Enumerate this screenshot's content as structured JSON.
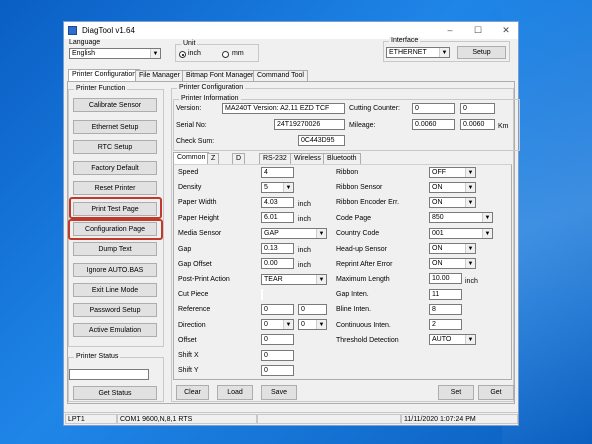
{
  "window": {
    "title": "DiagTool v1.64",
    "controls": [
      "–",
      "☐",
      "✕"
    ]
  },
  "language": {
    "label": "Language",
    "value": "English"
  },
  "unit": {
    "label": "Unit",
    "options": [
      "inch",
      "mm"
    ],
    "selected": "inch"
  },
  "interface": {
    "label": "Interface",
    "value": "ETHERNET",
    "setup_label": "Setup"
  },
  "tabs": [
    "Printer Configuration",
    "File Manager",
    "Bitmap Font Manager",
    "Command Tool"
  ],
  "printer_function": {
    "title": "Printer Function",
    "buttons": [
      "Calibrate Sensor",
      "Ethernet Setup",
      "RTC Setup",
      "Factory Default",
      "Reset Printer",
      "Print Test Page",
      "Configuration Page",
      "Dump Text",
      "Ignore AUTO.BAS",
      "Exit Line Mode",
      "Password Setup",
      "Active Emulation"
    ]
  },
  "printer_status": {
    "title": "Printer Status",
    "value": "",
    "button": "Get Status"
  },
  "printer_config": {
    "title": "Printer Configuration",
    "info_title": "Printer Information",
    "version_label": "Version:",
    "version": "MA240T Version: A2.11 EZD TCF",
    "serial_label": "Serial No:",
    "serial": "24T19270026",
    "checksum_label": "Check Sum:",
    "checksum": "0C443D95",
    "cutting_label": "Cutting Counter:",
    "cutting1": "0",
    "cutting2": "0",
    "mileage_label": "Mileage:",
    "mileage1": "0.0060",
    "mileage2": "0.0060",
    "mileage_unit": "Km"
  },
  "subtabs": [
    "Common",
    "Z",
    "D",
    "RS-232",
    "Wireless",
    "Bluetooth"
  ],
  "common": {
    "speed": {
      "label": "Speed",
      "value": "4"
    },
    "density": {
      "label": "Density",
      "value": "5"
    },
    "paper_width": {
      "label": "Paper Width",
      "value": "4.03",
      "unit": "inch"
    },
    "paper_height": {
      "label": "Paper Height",
      "value": "6.01",
      "unit": "inch"
    },
    "media_sensor": {
      "label": "Media Sensor",
      "value": "GAP"
    },
    "gap": {
      "label": "Gap",
      "value": "0.13",
      "unit": "inch"
    },
    "gap_offset": {
      "label": "Gap Offset",
      "value": "0.00",
      "unit": "inch"
    },
    "post_print": {
      "label": "Post-Print Action",
      "value": "TEAR"
    },
    "cut_piece": {
      "label": "Cut Piece",
      "value": ""
    },
    "reference": {
      "label": "Reference",
      "value1": "0",
      "value2": "0"
    },
    "direction": {
      "label": "Direction",
      "value1": "0",
      "value2": "0"
    },
    "offset": {
      "label": "Offset",
      "value": "0"
    },
    "shift_x": {
      "label": "Shift X",
      "value": "0"
    },
    "shift_y": {
      "label": "Shift Y",
      "value": "0"
    },
    "ribbon": {
      "label": "Ribbon",
      "value": "OFF"
    },
    "ribbon_sensor": {
      "label": "Ribbon Sensor",
      "value": "ON"
    },
    "ribbon_encoder": {
      "label": "Ribbon Encoder Err.",
      "value": "ON"
    },
    "code_page": {
      "label": "Code Page",
      "value": "850"
    },
    "country_code": {
      "label": "Country Code",
      "value": "001"
    },
    "headup_sensor": {
      "label": "Head-up Sensor",
      "value": "ON"
    },
    "reprint": {
      "label": "Reprint After Error",
      "value": "ON"
    },
    "max_length": {
      "label": "Maximum Length",
      "value": "10.00",
      "unit": "inch"
    },
    "gap_inten": {
      "label": "Gap Inten.",
      "value": "11"
    },
    "bline_inten": {
      "label": "Bline Inten.",
      "value": "8"
    },
    "cont_inten": {
      "label": "Continuous Inten.",
      "value": "2"
    },
    "threshold": {
      "label": "Threshold Detection",
      "value": "AUTO"
    }
  },
  "bottom_buttons": {
    "clear": "Clear",
    "load": "Load",
    "save": "Save",
    "set": "Set",
    "get": "Get"
  },
  "statusbar": {
    "port": "LPT1",
    "com": "COM1 9600,N,8,1 RTS",
    "middle": "",
    "datetime": "11/11/2020 1:07:24 PM"
  }
}
